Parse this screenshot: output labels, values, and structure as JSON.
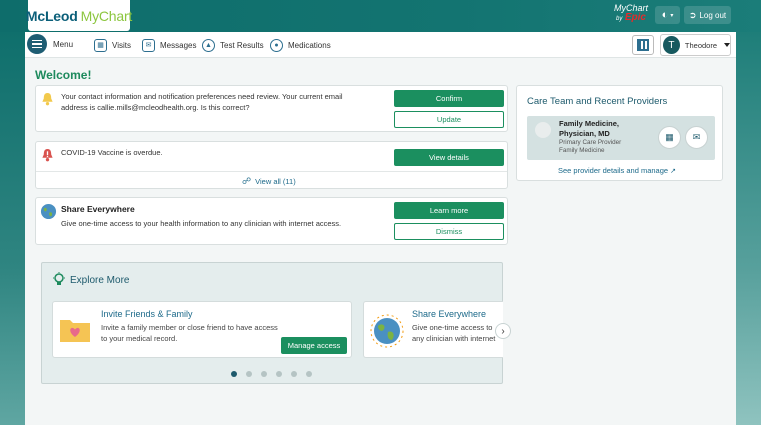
{
  "brand": {
    "name_primary": "McLeod",
    "name_secondary": "MyChart",
    "epic_top": "MyChart",
    "epic_by": "by",
    "epic_name": "Epic"
  },
  "header": {
    "logout_label": "Log out",
    "lang_icon": "globe-icon"
  },
  "nav": {
    "menu_label": "Menu",
    "items": [
      {
        "label": "Visits",
        "icon": "calendar-icon"
      },
      {
        "label": "Messages",
        "icon": "envelope-icon"
      },
      {
        "label": "Test Results",
        "icon": "flask-icon"
      },
      {
        "label": "Medications",
        "icon": "pill-icon"
      }
    ],
    "user": {
      "initial": "T",
      "name": "Theodore"
    }
  },
  "welcome": "Welcome!",
  "alerts": {
    "contact": {
      "text": "Your contact information and notification preferences need review. Your current email address is callie.mills@mcleodhealth.org. Is this correct?",
      "confirm": "Confirm",
      "update": "Update"
    },
    "covid": {
      "text": "COVID-19 Vaccine is overdue.",
      "details": "View details",
      "view_all": "View all (11)"
    },
    "share": {
      "title": "Share Everywhere",
      "text": "Give one-time access to your health information to any clinician with internet access.",
      "learn": "Learn more",
      "dismiss": "Dismiss"
    }
  },
  "care_team": {
    "title": "Care Team and Recent Providers",
    "provider_name_line1": "Family Medicine,",
    "provider_name_line2": "Physician, MD",
    "provider_role": "Primary Care Provider",
    "provider_dept": "Family Medicine",
    "see_more": "See provider details and manage"
  },
  "explore": {
    "title": "Explore More",
    "cards": [
      {
        "title": "Invite Friends & Family",
        "text": "Invite a family member or close friend to have access to your medical record.",
        "button": "Manage access"
      },
      {
        "title": "Share Everywhere",
        "text": "Give one-time access to any clinician with internet access"
      }
    ],
    "pages": 6,
    "active_page": 1
  },
  "colors": {
    "teal_header": "#0f6f6c",
    "green_button": "#1b8f5f",
    "link_blue": "#1d6a8a"
  }
}
